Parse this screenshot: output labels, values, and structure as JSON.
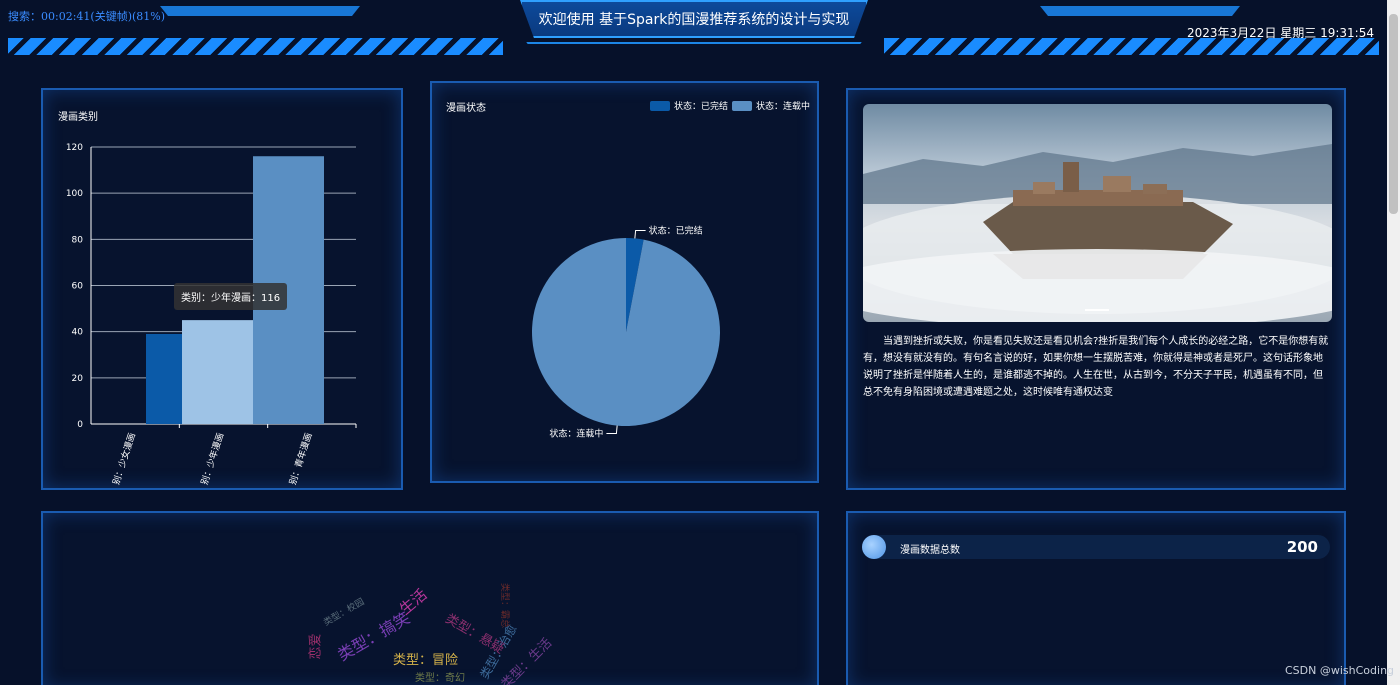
{
  "header": {
    "title": "欢迎使用 基于Spark的国漫推荐系统的设计与实现",
    "search_status": "搜索：00:02:41(关键帧)(81%)",
    "datetime": "2023年3月22日 星期三 19:31:54"
  },
  "panel_category": {
    "title": "漫画类别",
    "tooltip": "类别：少年漫画：116",
    "chart_data": {
      "type": "bar",
      "categories": [
        "别：少女漫画",
        "别：少年漫画",
        "别：青年漫画"
      ],
      "values": [
        39,
        45,
        116
      ],
      "ylim": [
        0,
        120
      ],
      "yticks": [
        0,
        20,
        40,
        60,
        80,
        100,
        120
      ],
      "colors": [
        "#0b5aa8",
        "#9ec3e6",
        "#5a8fc3"
      ],
      "grid": true
    }
  },
  "panel_status": {
    "title": "漫画状态",
    "legend": [
      {
        "label": "状态：已完结",
        "color": "#0b5aa8"
      },
      {
        "label": "状态：连载中",
        "color": "#5a8fc3"
      }
    ],
    "chart_data": {
      "type": "pie",
      "labels": [
        "状态：已完结",
        "状态：连载中"
      ],
      "values": [
        6,
        194
      ],
      "colors": [
        "#0b5aa8",
        "#5a8fc3"
      ]
    }
  },
  "panel_intro": {
    "quote": "当遇到挫折或失败，你是看见失败还是看见机会?挫折是我们每个人成长的必经之路，它不是你想有就有，想没有就没有的。有句名言说的好，如果你想一生摆脱苦难，你就得是神或者是死尸。这句话形象地说明了挫折是伴随着人生的，是谁都逃不掉的。人生在世，从古到今，不分天子平民，机遇虽有不同，但总不免有身陷困境或遭遇难题之处，这时候唯有通权达变"
  },
  "panel_stats": {
    "label": "漫画数据总数",
    "value": "200"
  },
  "wordcloud": {
    "words": [
      {
        "text": "类型：冒险",
        "color": "#d4b24a"
      },
      {
        "text": "类型：搞笑",
        "color": "#7a3fb5"
      },
      {
        "text": "生活",
        "color": "#b8369b"
      },
      {
        "text": "类型：悬疑",
        "color": "#8a2f6e"
      },
      {
        "text": "类型：治愈",
        "color": "#3d6b9a"
      },
      {
        "text": "类型：生活",
        "color": "#6a3a8a"
      },
      {
        "text": "类型：奇幻",
        "color": "#6e7a4a"
      },
      {
        "text": "类型：校园",
        "color": "#5a6d7a"
      },
      {
        "text": "类型：霸总",
        "color": "#6a2a2a"
      },
      {
        "text": "恋爱",
        "color": "#9a2f6a"
      }
    ]
  },
  "watermark": "CSDN @wishCoding"
}
